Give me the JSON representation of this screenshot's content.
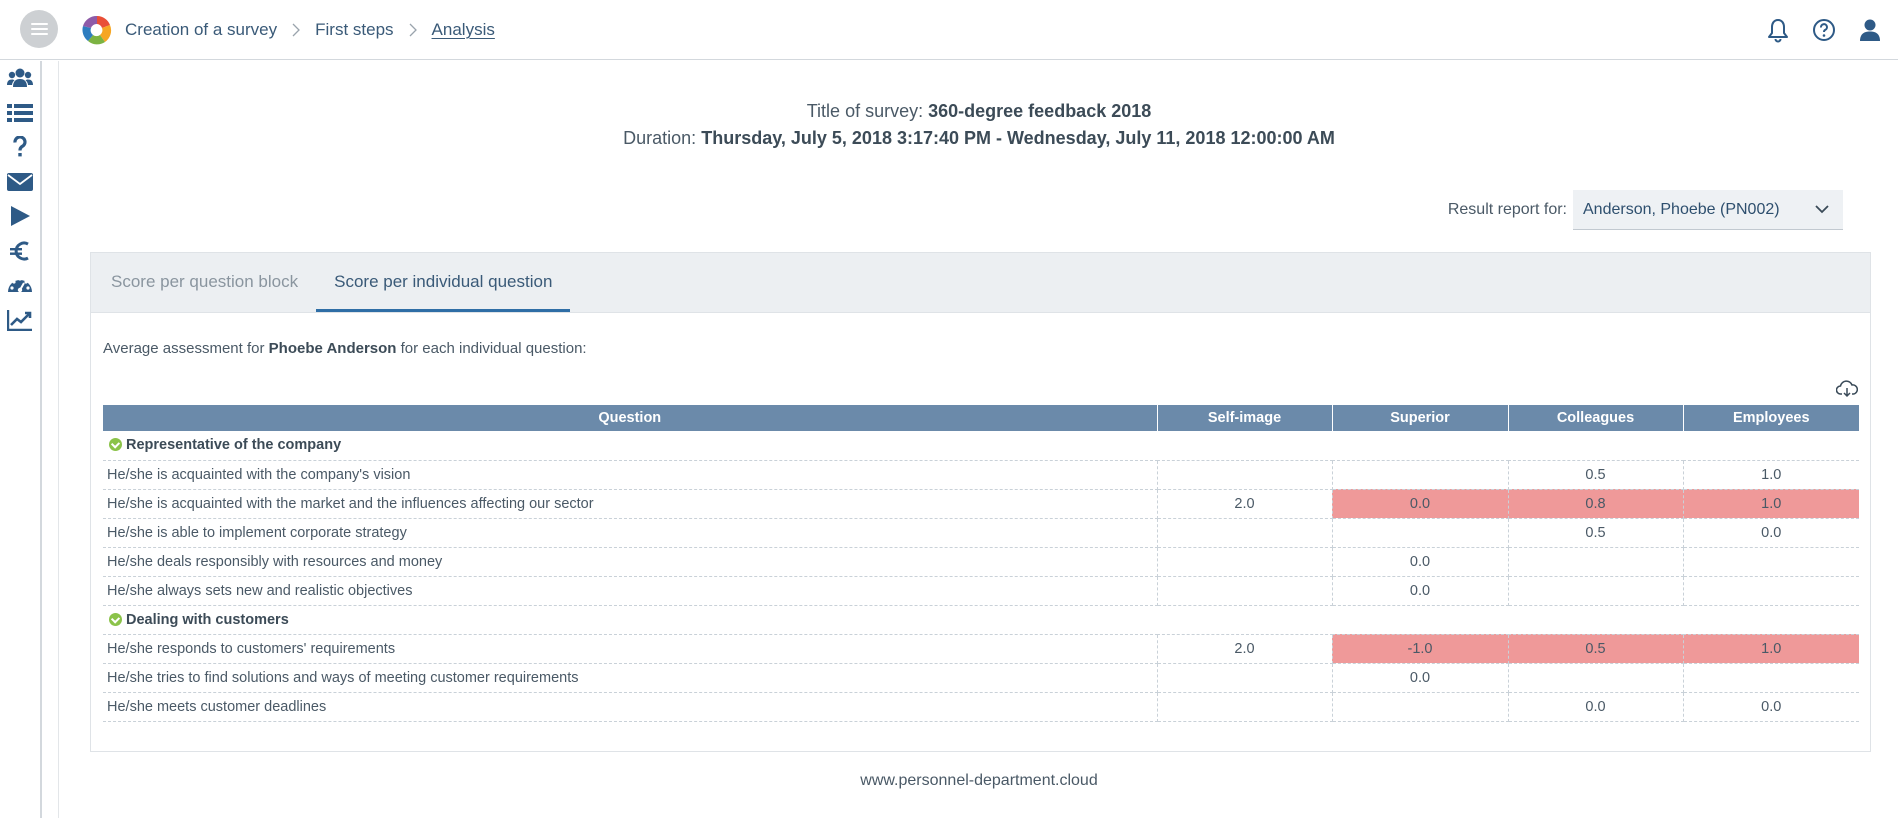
{
  "breadcrumb": [
    "Creation of a survey",
    "First steps",
    "Analysis"
  ],
  "survey": {
    "title_label": "Title of survey:",
    "title_value": "360-degree feedback 2018",
    "duration_label": "Duration:",
    "duration_value": "Thursday, July 5, 2018 3:17:40 PM - Wednesday, July 11, 2018 12:00:00 AM"
  },
  "report": {
    "label": "Result report for:",
    "selected": "Anderson, Phoebe (PN002)"
  },
  "tabs": [
    "Score per question block",
    "Score per individual question"
  ],
  "assessment": {
    "prefix": "Average assessment for",
    "name": "Phoebe Anderson",
    "suffix": "for each individual question:"
  },
  "table": {
    "headers": [
      "Question",
      "Self-image",
      "Superior",
      "Colleagues",
      "Employees"
    ],
    "groups": [
      {
        "name": "Representative of the company",
        "rows": [
          {
            "q": "He/she is acquainted with the company's vision",
            "self": "",
            "superior": "",
            "colleagues": "0.5",
            "employees": "1.0",
            "highlight": false
          },
          {
            "q": "He/she is acquainted with the market and the influences affecting our sector",
            "self": "2.0",
            "superior": "0.0",
            "colleagues": "0.8",
            "employees": "1.0",
            "highlight": true
          },
          {
            "q": "He/she is able to implement corporate strategy",
            "self": "",
            "superior": "",
            "colleagues": "0.5",
            "employees": "0.0",
            "highlight": false
          },
          {
            "q": "He/she deals responsibly with resources and money",
            "self": "",
            "superior": "0.0",
            "colleagues": "",
            "employees": "",
            "highlight": false
          },
          {
            "q": "He/she always sets new and realistic objectives",
            "self": "",
            "superior": "0.0",
            "colleagues": "",
            "employees": "",
            "highlight": false
          }
        ]
      },
      {
        "name": "Dealing with customers",
        "rows": [
          {
            "q": "He/she responds to customers' requirements",
            "self": "2.0",
            "superior": "-1.0",
            "colleagues": "0.5",
            "employees": "1.0",
            "highlight": true
          },
          {
            "q": "He/she tries to find solutions and ways of meeting customer requirements",
            "self": "",
            "superior": "0.0",
            "colleagues": "",
            "employees": "",
            "highlight": false
          },
          {
            "q": "He/she meets customer deadlines",
            "self": "",
            "superior": "",
            "colleagues": "0.0",
            "employees": "0.0",
            "highlight": false
          }
        ]
      }
    ]
  },
  "footer": "www.personnel-department.cloud",
  "colors": {
    "accent": "#2f6ea6",
    "header_bg": "#6b8aaa",
    "highlight": "#ef9999",
    "group_icon": "#8bc34a",
    "icon": "#2e5a86"
  },
  "icons": {
    "top": [
      "bell-icon",
      "help-icon",
      "user-icon"
    ],
    "sidebar": [
      "users-icon",
      "list-icon",
      "question-icon",
      "mail-icon",
      "play-icon",
      "euro-icon",
      "dashboard-icon",
      "chart-icon"
    ]
  }
}
